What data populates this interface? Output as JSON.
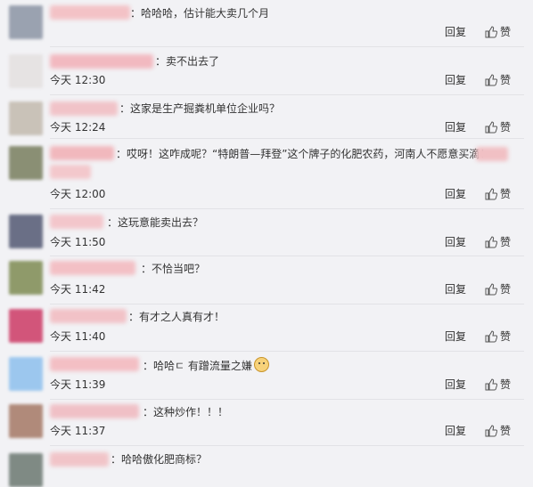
{
  "actions": {
    "reply_label": "回复",
    "like_label": "赞"
  },
  "comments": [
    {
      "text": "：哈哈哈，估计能大卖几个月",
      "time": "",
      "avatar_color": "#9aa2b0",
      "name_color": "#f3c2c6"
    },
    {
      "text": "：卖不出去了",
      "time": "今天 12:30",
      "avatar_color": "#e6e3e3",
      "name_color": "#f2b9c0"
    },
    {
      "text": "：这家是生产掘粪机单位企业吗？",
      "time": "今天 12:24",
      "avatar_color": "#c9c2b8",
      "name_color": "#f1c3c8"
    },
    {
      "text": "：哎呀！这咋成呢？“特朗普—拜登”这个牌子的化肥农药，河南人不愿意买滴！",
      "time": "今天 12:00",
      "avatar_color": "#8a8f74",
      "name_color": "#f1b8bd"
    },
    {
      "text": "：这玩意能卖出去？",
      "time": "今天 11:50",
      "avatar_color": "#6a6f86",
      "name_color": "#f3c6cb"
    },
    {
      "text": "：不恰当吧？",
      "time": "今天 11:42",
      "avatar_color": "#8f9a6a",
      "name_color": "#f3c0c5"
    },
    {
      "text": "：有才之人真有才！",
      "time": "今天 11:40",
      "avatar_color": "#d2557a",
      "name_color": "#f2c2c7"
    },
    {
      "text": "：哈哈ㄷ 有蹭流量之嫌",
      "time": "今天 11:39",
      "avatar_color": "#9cc7ee",
      "name_color": "#f3bfc4"
    },
    {
      "text": "：这种炒作！！！",
      "time": "今天 11:37",
      "avatar_color": "#b08a7a",
      "name_color": "#f0c0c6"
    },
    {
      "text": "：哈哈傲化肥商标？",
      "time": "",
      "avatar_color": "#7f8a84",
      "name_color": "#f1c4c8"
    }
  ]
}
